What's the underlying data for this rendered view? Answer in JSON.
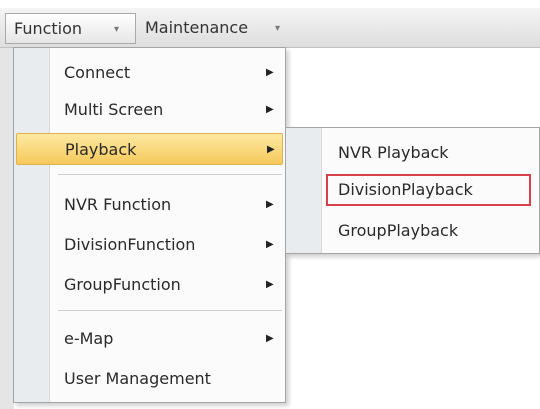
{
  "menubar": {
    "items": [
      {
        "label": "Function",
        "caret": "▾"
      },
      {
        "label": "Maintenance",
        "caret": "▾"
      }
    ]
  },
  "function_menu": {
    "items": [
      {
        "label": "Connect",
        "arrow": "▶"
      },
      {
        "label": "Multi Screen",
        "arrow": "▶"
      },
      {
        "label": "Playback",
        "arrow": "▶"
      },
      {
        "label": "NVR Function",
        "arrow": "▶"
      },
      {
        "label": "DivisionFunction",
        "arrow": "▶"
      },
      {
        "label": "GroupFunction",
        "arrow": "▶"
      },
      {
        "label": "e-Map",
        "arrow": "▶"
      },
      {
        "label": "User Management",
        "arrow": ""
      }
    ],
    "highlighted_color": "#f6c95b"
  },
  "playback_submenu": {
    "items": [
      {
        "label": "NVR Playback"
      },
      {
        "label": "DivisionPlayback"
      },
      {
        "label": "GroupPlayback"
      }
    ],
    "annotation_color": "#d9404a"
  }
}
